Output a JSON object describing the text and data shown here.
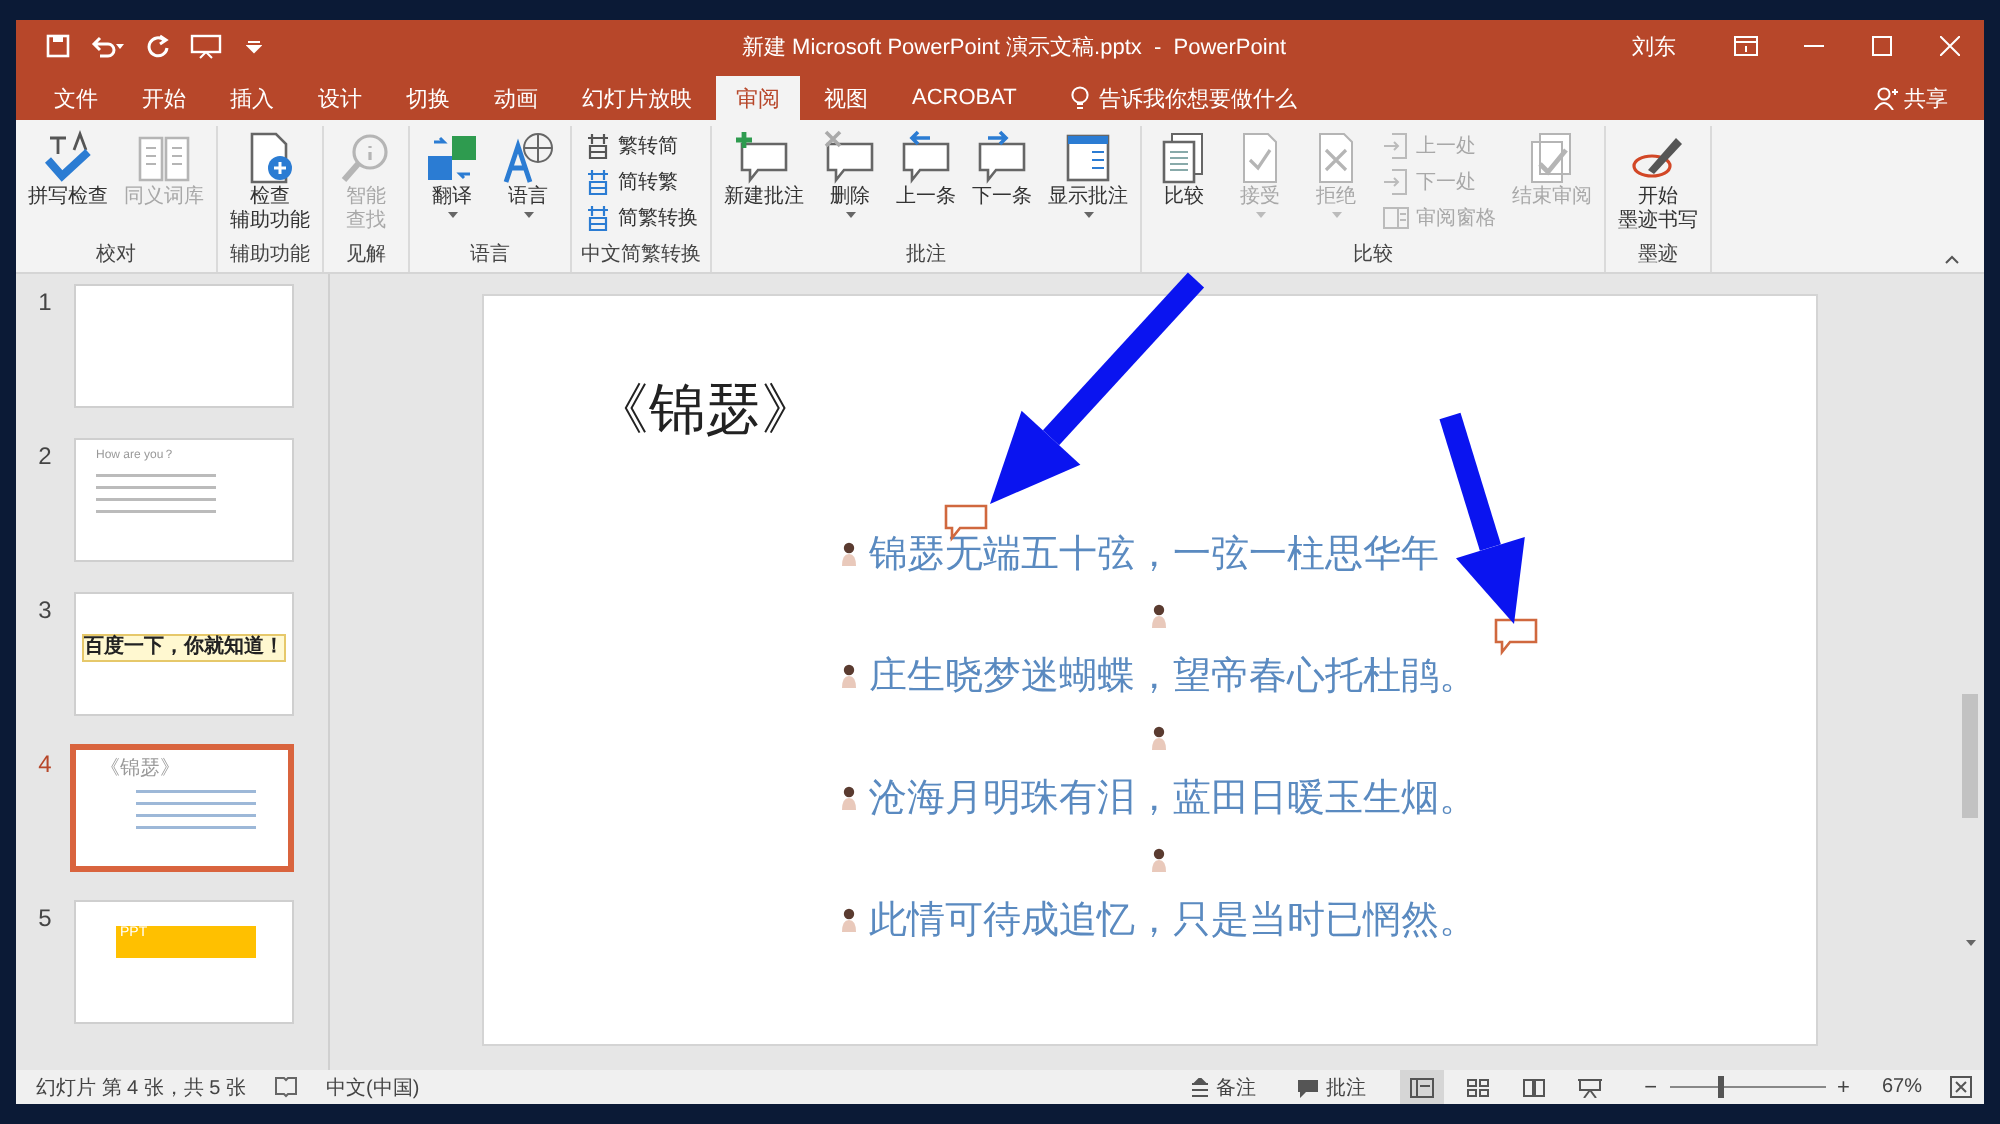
{
  "window": {
    "title": "新建 Microsoft PowerPoint 演示文稿.pptx  -  PowerPoint",
    "user": "刘东"
  },
  "tabs": [
    {
      "label": "文件",
      "selected": false
    },
    {
      "label": "开始",
      "selected": false
    },
    {
      "label": "插入",
      "selected": false
    },
    {
      "label": "设计",
      "selected": false
    },
    {
      "label": "切换",
      "selected": false
    },
    {
      "label": "动画",
      "selected": false
    },
    {
      "label": "幻灯片放映",
      "selected": false
    },
    {
      "label": "审阅",
      "selected": true
    },
    {
      "label": "视图",
      "selected": false
    },
    {
      "label": "ACROBAT",
      "selected": false
    }
  ],
  "tell_me": "告诉我你想要做什么",
  "share": "共享",
  "ribbon": [
    {
      "label": "校对",
      "items": [
        {
          "kind": "large",
          "label": "拼写检查",
          "disabled": false,
          "dropdown": false
        },
        {
          "kind": "large",
          "label": "同义词库",
          "disabled": true,
          "dropdown": false
        }
      ]
    },
    {
      "label": "辅助功能",
      "items": [
        {
          "kind": "large",
          "lines": [
            "检查",
            "辅助功能"
          ],
          "disabled": false,
          "dropdown": false
        }
      ]
    },
    {
      "label": "见解",
      "items": [
        {
          "kind": "large",
          "lines": [
            "智能",
            "查找"
          ],
          "disabled": true,
          "dropdown": false
        }
      ]
    },
    {
      "label": "语言",
      "items": [
        {
          "kind": "large",
          "label": "翻译",
          "disabled": false,
          "dropdown": true
        },
        {
          "kind": "large",
          "label": "语言",
          "disabled": false,
          "dropdown": true
        }
      ]
    },
    {
      "label": "中文简繁转换",
      "items": [
        {
          "kind": "stack",
          "items": [
            {
              "label": "繁转简",
              "disabled": false
            },
            {
              "label": "简转繁",
              "disabled": false
            },
            {
              "label": "简繁转换",
              "disabled": false
            }
          ]
        }
      ]
    },
    {
      "label": "批注",
      "items": [
        {
          "kind": "large",
          "label": "新建批注",
          "disabled": false,
          "dropdown": false
        },
        {
          "kind": "large",
          "label": "删除",
          "disabled": false,
          "dropdown": true
        },
        {
          "kind": "large",
          "label": "上一条",
          "disabled": false,
          "dropdown": false
        },
        {
          "kind": "large",
          "label": "下一条",
          "disabled": false,
          "dropdown": false
        },
        {
          "kind": "large",
          "label": "显示批注",
          "disabled": false,
          "dropdown": true
        }
      ]
    },
    {
      "label": "比较",
      "items": [
        {
          "kind": "large",
          "label": "比较",
          "disabled": false,
          "dropdown": false
        },
        {
          "kind": "large",
          "label": "接受",
          "disabled": true,
          "dropdown": true
        },
        {
          "kind": "large",
          "label": "拒绝",
          "disabled": true,
          "dropdown": true
        },
        {
          "kind": "stack",
          "items": [
            {
              "label": "上一处",
              "disabled": true
            },
            {
              "label": "下一处",
              "disabled": true
            },
            {
              "label": "审阅窗格",
              "disabled": true
            }
          ]
        },
        {
          "kind": "large",
          "label": "结束审阅",
          "disabled": true,
          "dropdown": false
        }
      ]
    },
    {
      "label": "墨迹",
      "items": [
        {
          "kind": "large",
          "lines": [
            "开始",
            "墨迹书写"
          ],
          "disabled": false,
          "dropdown": false
        }
      ]
    }
  ],
  "slides": [
    {
      "number": "1",
      "selected": false,
      "kind": "blank"
    },
    {
      "number": "2",
      "selected": false,
      "kind": "text",
      "title": "How are you？"
    },
    {
      "number": "3",
      "selected": false,
      "kind": "banner",
      "title": "百度一下，你就知道！"
    },
    {
      "number": "4",
      "selected": true,
      "kind": "text",
      "title": "《锦瑟》"
    },
    {
      "number": "5",
      "selected": false,
      "kind": "block",
      "title": "PPT"
    }
  ],
  "slide": {
    "title": "《锦瑟》",
    "lines": [
      {
        "text": "锦瑟无端五十弦，一弦一柱思华年",
        "comment": true
      },
      {
        "text": "庄生晓梦迷蝴蝶，望帝春心托杜鹃。",
        "comment": true
      },
      {
        "text": "沧海月明珠有泪，蓝田日暖玉生烟。",
        "comment": false
      },
      {
        "text": "此情可待成追忆，只是当时已惘然。",
        "comment": false
      }
    ]
  },
  "overlay_arrows": [
    {
      "kind": "arrow"
    },
    {
      "kind": "arrow"
    }
  ],
  "status_bar": {
    "slide_info": "幻灯片 第 4 张，共 5 张",
    "language": "中文(中国)",
    "notes": "备注",
    "comments": "批注",
    "views": [
      {
        "selected": true
      },
      {
        "selected": false
      },
      {
        "selected": false
      },
      {
        "selected": false
      }
    ],
    "zoom_out": "−",
    "zoom_in": "+",
    "zoom": {
      "level": 0.33
    },
    "zoom_text": "67%"
  }
}
